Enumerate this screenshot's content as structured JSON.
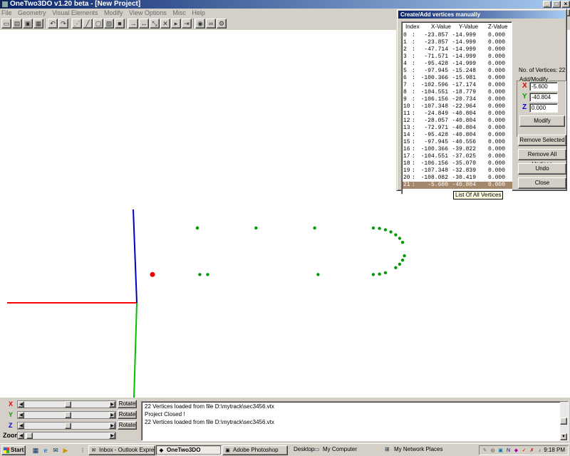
{
  "app": {
    "title": "OneTwo3DO v1.20 beta - [New Project]",
    "menu": [
      "File",
      "Geometry",
      "Visual Elements",
      "Modify",
      "View Options",
      "Misc",
      "Help"
    ],
    "toolbar_icons": [
      "new-icon",
      "open-icon",
      "save-icon",
      "save-as-icon",
      "undo-icon",
      "redo-icon",
      "select-icon",
      "draw-line-icon",
      "draw-rect-icon",
      "texture-icon",
      "fill-icon",
      "move-icon",
      "move-both-icon",
      "scale-icon",
      "rotate-icon",
      "play-icon",
      "step-icon",
      "eye-icon",
      "glasses-icon",
      "settings-icon"
    ]
  },
  "dialog": {
    "title": "Create/Add vertices manually",
    "list_headers": [
      "Index",
      "X-Value",
      "Y-Value",
      "Z-Value"
    ],
    "vertices": [
      [
        "0",
        "-23.857",
        "-14.999",
        "0.000"
      ],
      [
        "1",
        "-23.857",
        "-14.999",
        "0.000"
      ],
      [
        "2",
        "-47.714",
        "-14.999",
        "0.000"
      ],
      [
        "3",
        "-71.571",
        "-14.999",
        "0.000"
      ],
      [
        "4",
        "-95.428",
        "-14.999",
        "0.000"
      ],
      [
        "5",
        "-97.945",
        "-15.248",
        "0.000"
      ],
      [
        "6",
        "-100.366",
        "-15.981",
        "0.000"
      ],
      [
        "7",
        "-102.596",
        "-17.174",
        "0.000"
      ],
      [
        "8",
        "-104.551",
        "-18.779",
        "0.000"
      ],
      [
        "9",
        "-106.156",
        "-20.734",
        "0.000"
      ],
      [
        "10",
        "-107.348",
        "-22.964",
        "0.000"
      ],
      [
        "11",
        "-24.849",
        "-40.804",
        "0.000"
      ],
      [
        "12",
        "-28.057",
        "-40.804",
        "0.000"
      ],
      [
        "13",
        "-72.971",
        "-40.804",
        "0.000"
      ],
      [
        "14",
        "-95.428",
        "-40.804",
        "0.000"
      ],
      [
        "15",
        "-97.945",
        "-40.556",
        "0.000"
      ],
      [
        "16",
        "-100.366",
        "-39.822",
        "0.000"
      ],
      [
        "17",
        "-104.551",
        "-37.025",
        "0.000"
      ],
      [
        "18",
        "-106.156",
        "-35.070",
        "0.000"
      ],
      [
        "19",
        "-107.348",
        "-32.839",
        "0.000"
      ],
      [
        "20",
        "-108.082",
        "-30.419",
        "0.000"
      ],
      [
        "21",
        "-5.600",
        "-40.804",
        "0.000"
      ]
    ],
    "selected_index": 21,
    "vertex_count_label": "No. of Vertices: 22",
    "group_label": "Add/Modify",
    "x_label": "X",
    "x_value": "-5.600",
    "y_label": "Y",
    "y_value": "-40.804",
    "z_label": "Z",
    "z_value": "0.000",
    "modify_label": "Modify",
    "remove_selected_label": "Remove Selected",
    "remove_all_label": "Remove All Vertices",
    "undo_label": "Undo",
    "close_label": "Close",
    "tooltip": "List Of All Vertices"
  },
  "rotation": {
    "rows": [
      {
        "label": "X",
        "color": "#e00000",
        "button": "Rotate"
      },
      {
        "label": "Y",
        "color": "#00a000",
        "button": "Rotate"
      },
      {
        "label": "Z",
        "color": "#0000d0",
        "button": "Rotate"
      }
    ],
    "zoom_label": "Zoom"
  },
  "log": [
    "22 Vertices loaded from file D:\\mytrack\\sec3456.vtx",
    "Project Closed !",
    "22 Vertices loaded from file D:\\mytrack\\sec3456.vtx"
  ],
  "taskbar": {
    "start_label": "Start",
    "tasks": [
      {
        "label": "Inbox - Outlook Express",
        "icon": "outlook-icon",
        "active": false
      },
      {
        "label": "OneTwo3DO",
        "icon": "app-icon",
        "active": true
      },
      {
        "label": "Adobe Photoshop",
        "icon": "photoshop-icon",
        "active": false
      }
    ],
    "desktop_label": "Desktop",
    "my_computer_label": "My Computer",
    "network_label": "My Network Places",
    "clock": "9:18 PM"
  },
  "colors": {
    "x_axis": "#ff0000",
    "y_axis": "#00c000",
    "z_axis": "#0000c0",
    "vertex": "#009900",
    "selected_vertex": "#ee0000",
    "selection_row": "#a5886c"
  }
}
